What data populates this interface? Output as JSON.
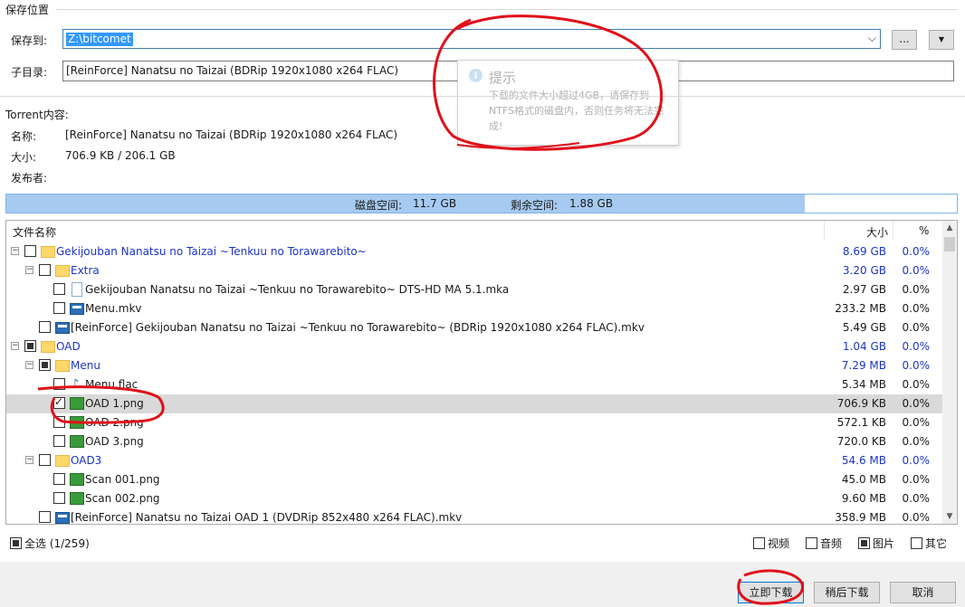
{
  "save_section": {
    "title": "保存位置",
    "save_to_label": "保存到:",
    "save_to_value": "Z:\\bitcomet",
    "browse_button": "...",
    "subdir_label": "子目录:",
    "subdir_value": "[ReinForce] Nanatsu no Taizai (BDRip 1920x1080 x264 FLAC)"
  },
  "tooltip": {
    "title": "提示",
    "body": "下载的文件大小超过4GB，请保存到NTFS格式的磁盘内，否则任务将无法完成!"
  },
  "torrent_info": {
    "title": "Torrent内容:",
    "name_label": "名称:",
    "name_value": "[ReinForce] Nanatsu no Taizai (BDRip 1920x1080 x264 FLAC)",
    "size_label": "大小:",
    "size_value": "706.9 KB / 206.1 GB",
    "publisher_label": "发布者:"
  },
  "disk": {
    "space_label": "磁盘空间:",
    "space_value": "11.7 GB",
    "free_label": "剩余空间:",
    "free_value": "1.88 GB",
    "used_fraction": 0.84
  },
  "file_list": {
    "columns": {
      "name": "文件名称",
      "size": "大小",
      "pct": "%"
    },
    "rows": [
      {
        "name": "Gekijouban Nanatsu no Taizai ~Tenkuu no Torawarebito~",
        "size": "8.69 GB",
        "pct": "0.0%"
      },
      {
        "name": "Extra",
        "size": "3.20 GB",
        "pct": "0.0%"
      },
      {
        "name": "Gekijouban Nanatsu no Taizai ~Tenkuu no Torawarebito~ DTS-HD MA 5.1.mka",
        "size": "2.97 GB",
        "pct": "0.0%"
      },
      {
        "name": "Menu.mkv",
        "size": "233.2 MB",
        "pct": "0.0%"
      },
      {
        "name": "[ReinForce] Gekijouban Nanatsu no Taizai ~Tenkuu no Torawarebito~ (BDRip 1920x1080 x264 FLAC).mkv",
        "size": "5.49 GB",
        "pct": "0.0%"
      },
      {
        "name": "OAD",
        "size": "1.04 GB",
        "pct": "0.0%"
      },
      {
        "name": "Menu",
        "size": "7.29 MB",
        "pct": "0.0%"
      },
      {
        "name": "Menu.flac",
        "size": "5.34 MB",
        "pct": "0.0%"
      },
      {
        "name": "OAD 1.png",
        "size": "706.9 KB",
        "pct": "0.0%"
      },
      {
        "name": "OAD 2.png",
        "size": "572.1 KB",
        "pct": "0.0%"
      },
      {
        "name": "OAD 3.png",
        "size": "720.0 KB",
        "pct": "0.0%"
      },
      {
        "name": "OAD3",
        "size": "54.6 MB",
        "pct": "0.0%"
      },
      {
        "name": "Scan 001.png",
        "size": "45.0 MB",
        "pct": "0.0%"
      },
      {
        "name": "Scan 002.png",
        "size": "9.60 MB",
        "pct": "0.0%"
      },
      {
        "name": "[ReinForce] Nanatsu no Taizai OAD 1 (DVDRip 852x480 x264 FLAC).mkv",
        "size": "358.9 MB",
        "pct": "0.0%"
      }
    ]
  },
  "filters": {
    "select_all": "全选 (1/259)",
    "video": "视频",
    "audio": "音频",
    "image": "图片",
    "other": "其它"
  },
  "buttons": {
    "download_now": "立即下载",
    "download_later": "稍后下载",
    "cancel": "取消"
  },
  "colors": {
    "folder_text": "#1c34c8",
    "annotation": "#e0101a",
    "disk_fill": "#a6caf0",
    "selection": "#0078d7"
  }
}
